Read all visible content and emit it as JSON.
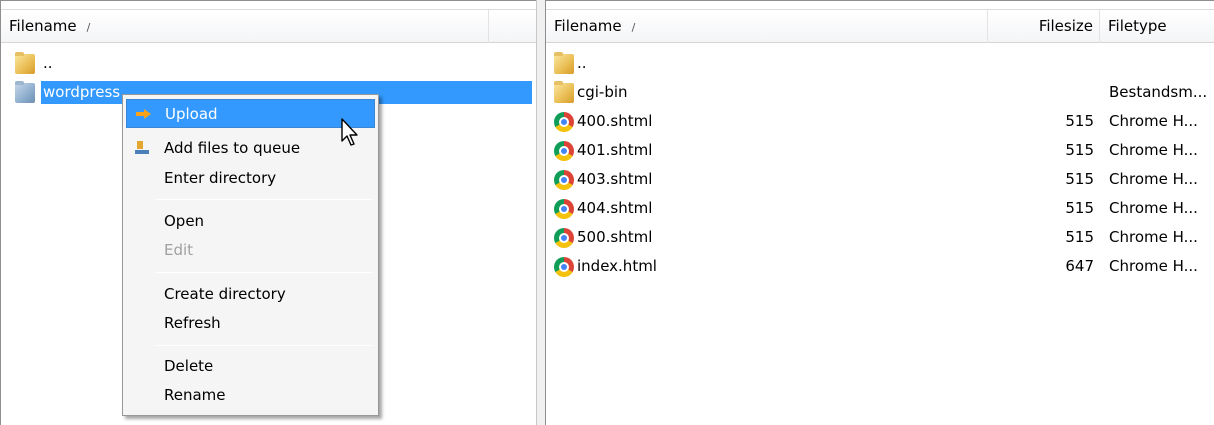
{
  "left_pane": {
    "header": {
      "filename_label": "Filename",
      "sort_indicator": "/"
    },
    "rows": [
      {
        "name": "..",
        "icon": "folder-icon"
      },
      {
        "name": "wordpress",
        "icon": "folder-icon",
        "selected": true
      }
    ]
  },
  "right_pane": {
    "header": {
      "filename_label": "Filename",
      "sort_indicator": "/",
      "filesize_label": "Filesize",
      "filetype_label": "Filetype"
    },
    "rows": [
      {
        "name": "..",
        "size": "",
        "type": "",
        "icon": "folder-icon"
      },
      {
        "name": "cgi-bin",
        "size": "",
        "type": "Bestandsm...",
        "icon": "folder-icon"
      },
      {
        "name": "400.shtml",
        "size": "515",
        "type": "Chrome H...",
        "icon": "chrome-icon"
      },
      {
        "name": "401.shtml",
        "size": "515",
        "type": "Chrome H...",
        "icon": "chrome-icon"
      },
      {
        "name": "403.shtml",
        "size": "515",
        "type": "Chrome H...",
        "icon": "chrome-icon"
      },
      {
        "name": "404.shtml",
        "size": "515",
        "type": "Chrome H...",
        "icon": "chrome-icon"
      },
      {
        "name": "500.shtml",
        "size": "515",
        "type": "Chrome H...",
        "icon": "chrome-icon"
      },
      {
        "name": "index.html",
        "size": "647",
        "type": "Chrome H...",
        "icon": "chrome-icon"
      }
    ]
  },
  "context_menu": {
    "items": {
      "upload": "Upload",
      "add_to_queue": "Add files to queue",
      "enter_directory": "Enter directory",
      "open": "Open",
      "edit": "Edit",
      "create_directory": "Create directory",
      "refresh": "Refresh",
      "delete": "Delete",
      "rename": "Rename"
    }
  },
  "colors": {
    "selection": "#3399ff",
    "menu_background": "#f5f5f5",
    "upload_arrow": "#f7a21b"
  }
}
